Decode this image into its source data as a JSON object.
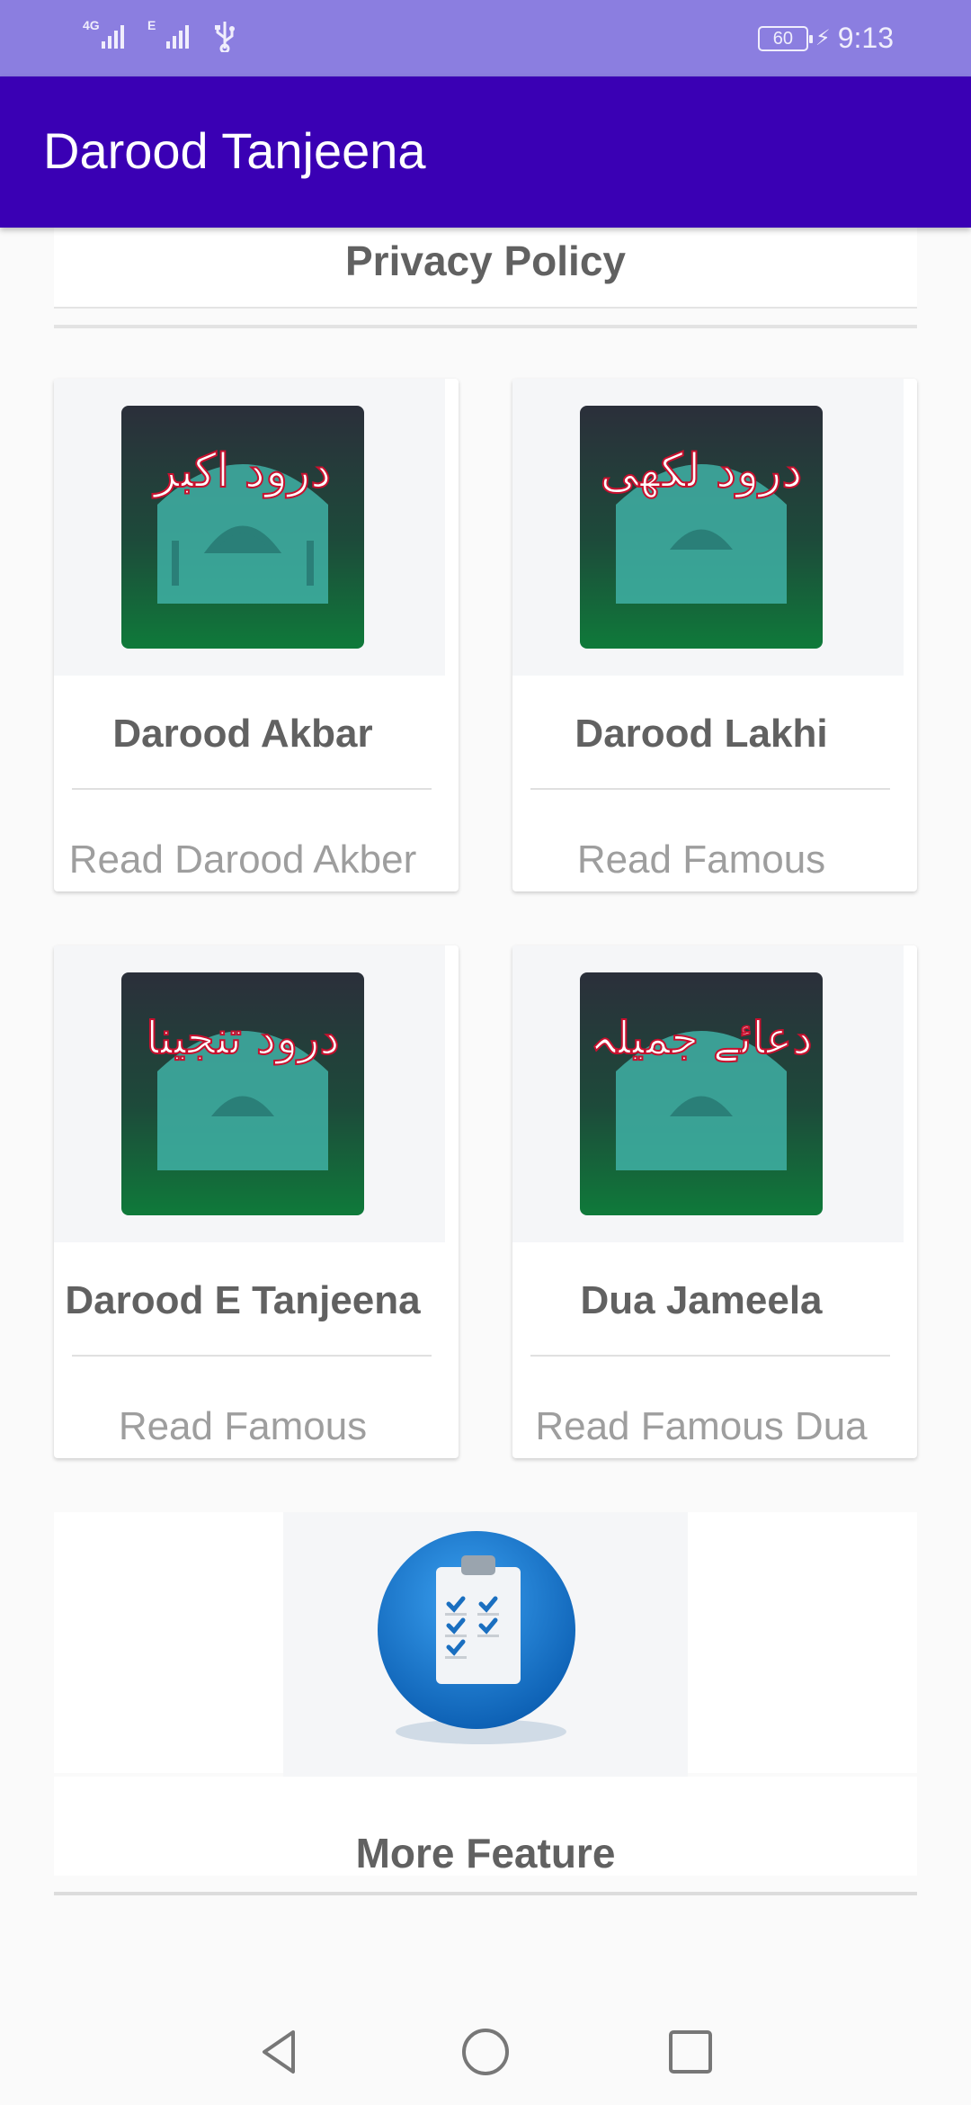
{
  "status_bar": {
    "signal1_tag": "4G",
    "signal2_tag": "E",
    "battery": "60",
    "time": "9:13",
    "colors": {
      "background": "#8b7ee0"
    }
  },
  "app_bar": {
    "title": "Darood Tanjeena",
    "color": "#3a00b4"
  },
  "privacy": {
    "label": "Privacy Policy"
  },
  "cards": [
    {
      "title": "Darood Akbar",
      "subtitle": "Read Darood Akber",
      "icon": "darood-akbar-icon"
    },
    {
      "title": "Darood Lakhi",
      "subtitle": "Read Famous",
      "icon": "darood-lakhi-icon"
    },
    {
      "title": "Darood E Tanjeena",
      "subtitle": "Read Famous",
      "icon": "darood-tanjeena-icon"
    },
    {
      "title": "Dua Jameela",
      "subtitle": "Read Famous Dua",
      "icon": "dua-jameela-icon"
    }
  ],
  "more": {
    "title": "More Feature",
    "icon": "checklist-icon"
  },
  "nav": {
    "back": "back-icon",
    "home": "home-icon",
    "recent": "recent-apps-icon"
  }
}
